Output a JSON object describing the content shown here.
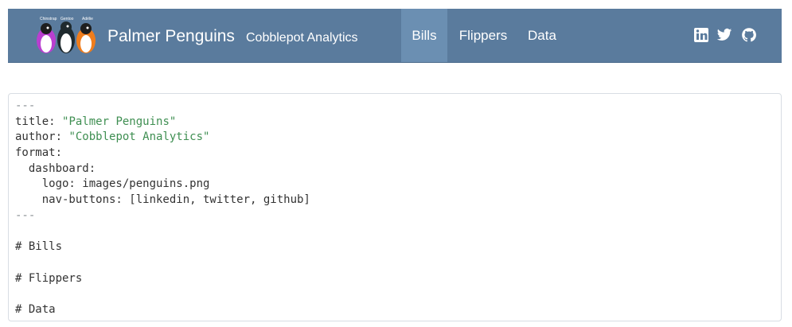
{
  "brand": {
    "title": "Palmer Penguins",
    "subtitle": "Cobblepot Analytics",
    "logo_label": "Logo with three cartoon penguins",
    "logo_names": [
      "Chinstrap",
      "Gentoo",
      "Adélie"
    ]
  },
  "nav": {
    "tabs": [
      {
        "label": "Bills",
        "active": true
      },
      {
        "label": "Flippers",
        "active": false
      },
      {
        "label": "Data",
        "active": false
      }
    ],
    "icons": [
      "linkedin-icon",
      "twitter-icon",
      "github-icon"
    ]
  },
  "code": {
    "lines": [
      {
        "text": "---"
      },
      {
        "key": "title: ",
        "value": "\"Palmer Penguins\""
      },
      {
        "key": "author: ",
        "value": "\"Cobblepot Analytics\""
      },
      {
        "text": "format:"
      },
      {
        "text": "  dashboard:"
      },
      {
        "text": "    logo: images/penguins.png"
      },
      {
        "text": "    nav-buttons: [linkedin, twitter, github]"
      },
      {
        "text": "---"
      },
      {
        "text": "# Bills"
      },
      {
        "text": "# Flippers"
      },
      {
        "text": "# Data"
      }
    ]
  },
  "colors": {
    "navbar": "#5a7b9d",
    "active_tab": "#6b8fb2",
    "string": "#3f8f52",
    "muted": "#8a8f94"
  }
}
